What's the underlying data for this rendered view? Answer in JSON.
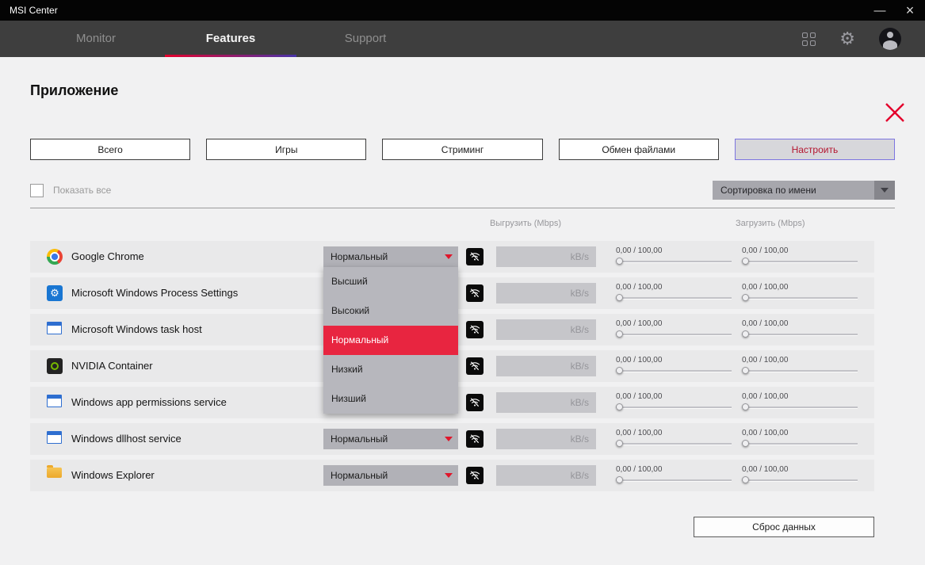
{
  "titlebar": {
    "title": "MSI Center",
    "minimize_glyph": "—",
    "close_glyph": "×"
  },
  "nav": {
    "tabs": [
      {
        "label": "Monitor",
        "active": false
      },
      {
        "label": "Features",
        "active": true
      },
      {
        "label": "Support",
        "active": false
      }
    ],
    "icons": [
      "apps-grid-icon",
      "gear-icon",
      "avatar"
    ]
  },
  "page": {
    "title": "Приложение",
    "accent_red": "#e4002b",
    "filters": [
      {
        "label": "Всего",
        "active": false
      },
      {
        "label": "Игры",
        "active": false
      },
      {
        "label": "Стриминг",
        "active": false
      },
      {
        "label": "Обмен файлами",
        "active": false
      },
      {
        "label": "Настроить",
        "active": true
      }
    ],
    "show_all": "Показать все",
    "show_all_checked": false,
    "sort": {
      "selected": "Сортировка по имени"
    },
    "columns": {
      "upload": "Выгрузить (Mbps)",
      "download": "Загрузить (Mbps)"
    },
    "dropdown": {
      "value": "Нормальный",
      "options": [
        "Высший",
        "Высокий",
        "Нормальный",
        "Низкий",
        "Низший"
      ],
      "selected_index": 2,
      "open_on_row": 0
    },
    "rate_unit": "kB/s",
    "slider_value": "0,00 / 100,00",
    "apps": [
      {
        "name": "Google Chrome",
        "icon": "chrome-icon"
      },
      {
        "name": "Microsoft Windows Process Settings",
        "icon": "settings-icon"
      },
      {
        "name": "Microsoft Windows task host",
        "icon": "window-icon"
      },
      {
        "name": "NVIDIA Container",
        "icon": "nvidia-icon"
      },
      {
        "name": "Windows app permissions service",
        "icon": "window-icon"
      },
      {
        "name": "Windows dllhost service",
        "icon": "window-icon"
      },
      {
        "name": "Windows Explorer",
        "icon": "folder-icon"
      }
    ],
    "reset": "Сброс данных"
  }
}
